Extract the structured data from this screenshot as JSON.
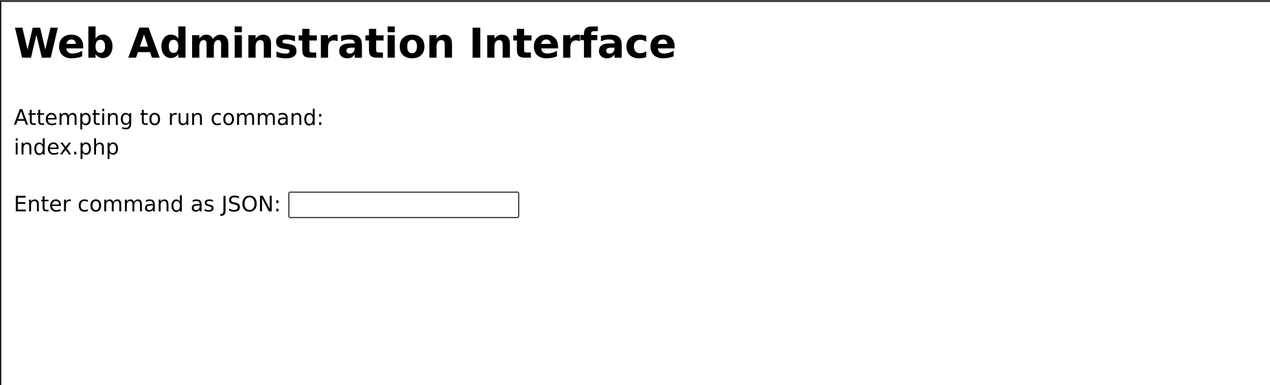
{
  "page": {
    "title": "Web Adminstration Interface",
    "status_label": "Attempting to run command:",
    "status_value": "index.php"
  },
  "form": {
    "command_label": "Enter command as JSON:",
    "command_value": "",
    "command_placeholder": ""
  }
}
